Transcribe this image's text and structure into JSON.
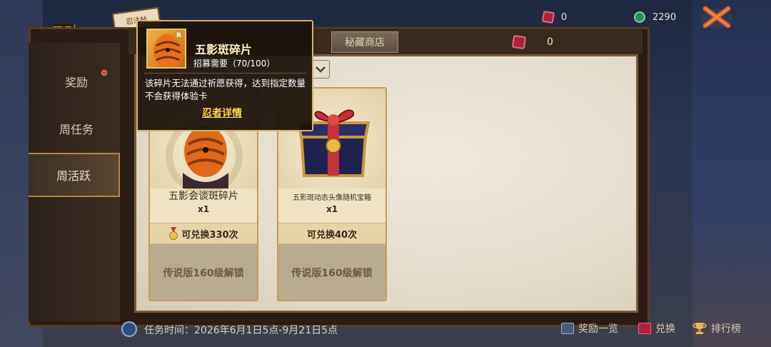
{
  "top": {
    "resources": [
      {
        "icon": "red-gem-icon",
        "value": "0",
        "color": "#b0203a"
      },
      {
        "icon": "green-jade-icon",
        "value": "2290",
        "color": "#2f8a5a"
      }
    ],
    "close_icon": "close-icon"
  },
  "logo": {
    "glyph": "忍",
    "scroll_text": "忍法帖"
  },
  "sidebar": {
    "items": [
      {
        "label": "奖励",
        "has_dot": true
      },
      {
        "label": "周任务",
        "has_dot": false
      },
      {
        "label": "周活跃",
        "active": true
      }
    ]
  },
  "tabs": [
    {
      "label": "秘藏商店"
    }
  ],
  "currency": {
    "value": "0",
    "icon": "red-gem-icon"
  },
  "cards": [
    {
      "name": "五影会谈斑碎片",
      "qty": "x1",
      "exchange": "可兑换330次",
      "exchange_icon": "medal-icon",
      "lock": "传说版160级解锁"
    },
    {
      "name": "五影斑动态头像随机宝箱",
      "qty": "x1",
      "exchange": "可兑换40次",
      "lock": "传说版160级解锁"
    }
  ],
  "tooltip": {
    "title": "五影斑碎片",
    "rank": "R",
    "need": "招募需要（70/100）",
    "desc": "该碎片无法通过祈愿获得，达到指定数量不会获得体验卡",
    "link": "忍者详情"
  },
  "bottom": {
    "task_time": "任务时间：2026年6月1日5点-9月21日5点",
    "buttons": [
      {
        "label": "奖励一览",
        "icon": "reward-list-icon"
      },
      {
        "label": "兑换",
        "icon": "exchange-icon"
      },
      {
        "label": "排行榜",
        "icon": "trophy-icon"
      }
    ]
  }
}
